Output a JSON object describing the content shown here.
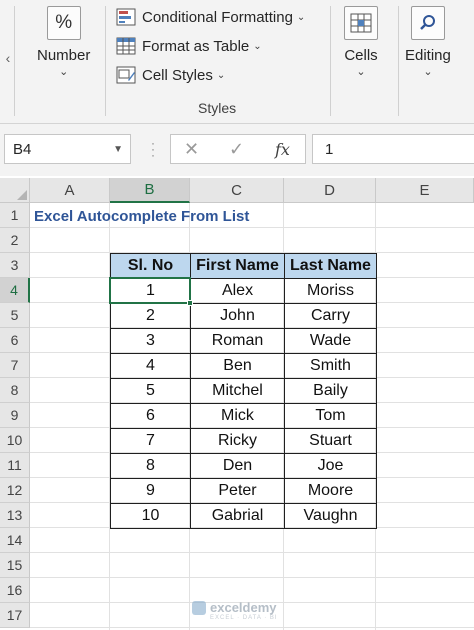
{
  "ribbon": {
    "scroll_left_glyph": "‹",
    "number": {
      "icon_glyph": "%",
      "label": "Number",
      "chevron": "⌄"
    },
    "styles": {
      "items": [
        {
          "label": "Conditional Formatting",
          "chevron": "⌄",
          "icon": "conditional-formatting-icon"
        },
        {
          "label": "Format as Table",
          "chevron": "⌄",
          "icon": "format-table-icon"
        },
        {
          "label": "Cell Styles",
          "chevron": "⌄",
          "icon": "cell-styles-icon"
        }
      ],
      "group_label": "Styles"
    },
    "cells": {
      "label": "Cells",
      "chevron": "⌄",
      "icon": "cells-icon"
    },
    "editing": {
      "label": "Editing",
      "chevron": "⌄",
      "icon": "search-icon"
    }
  },
  "formula_bar": {
    "name_box": "B4",
    "name_box_arrow": "▼",
    "cancel_glyph": "✕",
    "enter_glyph": "✓",
    "fx_glyph": "fx",
    "value": "1"
  },
  "grid": {
    "columns": [
      "A",
      "B",
      "C",
      "D",
      "E"
    ],
    "active_column": "B",
    "rows": [
      "1",
      "2",
      "3",
      "4",
      "5",
      "6",
      "7",
      "8",
      "9",
      "10",
      "11",
      "12",
      "13",
      "14",
      "15",
      "16",
      "17"
    ],
    "active_row": "4",
    "title": "Excel Autocomplete From List"
  },
  "table": {
    "headers": [
      "Sl. No",
      "First Name",
      "Last Name"
    ],
    "rows": [
      [
        "1",
        "Alex",
        "Moriss"
      ],
      [
        "2",
        "John",
        "Carry"
      ],
      [
        "3",
        "Roman",
        "Wade"
      ],
      [
        "4",
        "Ben",
        "Smith"
      ],
      [
        "5",
        "Mitchel",
        "Baily"
      ],
      [
        "6",
        "Mick",
        "Tom"
      ],
      [
        "7",
        "Ricky",
        "Stuart"
      ],
      [
        "8",
        "Den",
        "Joe"
      ],
      [
        "9",
        "Peter",
        "Moore"
      ],
      [
        "10",
        "Gabrial",
        "Vaughn"
      ]
    ]
  },
  "watermark": {
    "text": "exceldemy",
    "subtext": "EXCEL · DATA · BI"
  },
  "colors": {
    "accent_green": "#217346",
    "header_fill": "#bdd7ee",
    "title_blue": "#2f5597"
  }
}
